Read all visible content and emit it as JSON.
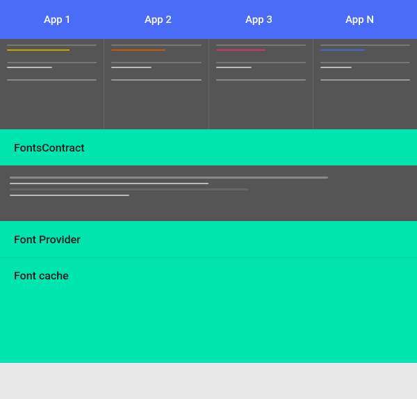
{
  "appBar": {
    "tabs": [
      {
        "id": "app1",
        "label": "App 1"
      },
      {
        "id": "app2",
        "label": "App 2"
      },
      {
        "id": "app3",
        "label": "App 3"
      },
      {
        "id": "appN",
        "label": "App N"
      }
    ]
  },
  "sections": {
    "fontsContract": "FontsContract",
    "fontProvider": "Font Provider",
    "fontCache": "Font cache"
  },
  "colors": {
    "appBarBg": "#5b73f5",
    "tealBg": "#00e5b0",
    "darkBg": "#555555"
  }
}
